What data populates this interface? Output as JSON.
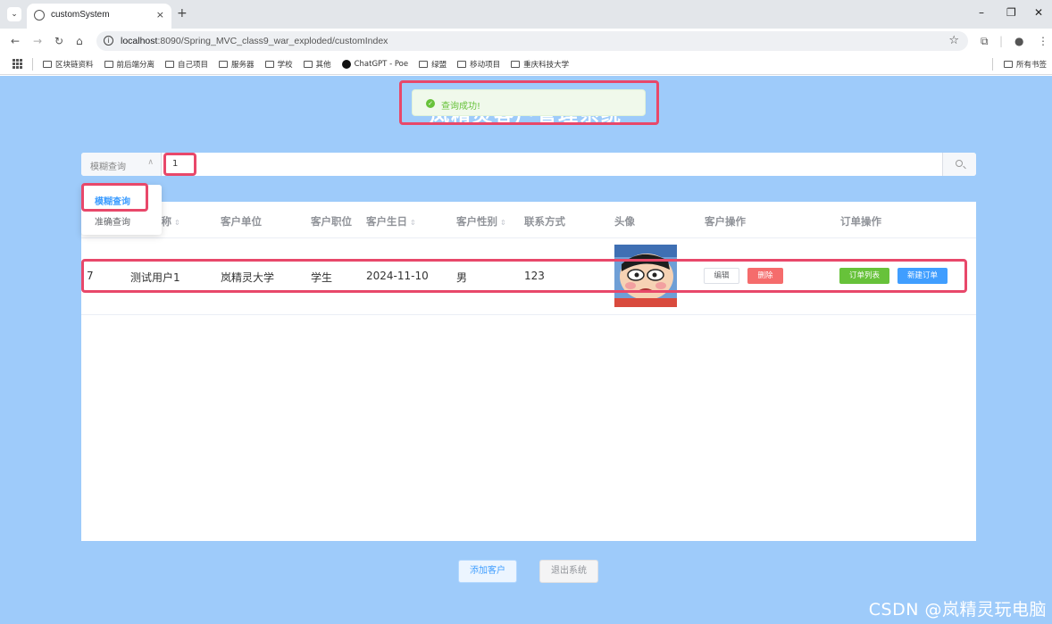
{
  "browser": {
    "tab_title": "customSystem",
    "tab_close": "×",
    "new_tab": "+",
    "window_controls": [
      "–",
      "❐",
      "✕"
    ],
    "url_host": "localhost",
    "url_rest": ":8090/Spring_MVC_class9_war_exploded/customIndex",
    "bookmarks": [
      "区块链资料",
      "前后端分离",
      "自己项目",
      "服务器",
      "学校",
      "其他",
      "ChatGPT - Poe",
      "绿盟",
      "移动项目",
      "重庆科技大学"
    ],
    "all_bookmarks": "所有书签"
  },
  "page": {
    "title": "岚精灵客户管理系统",
    "toast": "查询成功!",
    "search": {
      "mode": "模糊查询",
      "value": "1",
      "options": [
        "模糊查询",
        "准确查询"
      ]
    },
    "table": {
      "headers": [
        "客户名称",
        "客户单位",
        "客户职位",
        "客户生日",
        "客户性别",
        "联系方式",
        "头像",
        "客户操作",
        "订单操作"
      ],
      "rows": [
        {
          "id": "7",
          "name": "测试用户1",
          "unit": "岚精灵大学",
          "position": "学生",
          "birthday": "2024-11-10",
          "gender": "男",
          "phone": "123"
        }
      ],
      "actions": {
        "edit": "编辑",
        "delete": "删除",
        "orders": "订单列表",
        "new_order": "新建订单"
      }
    },
    "buttons": {
      "add": "添加客户",
      "exit": "退出系统"
    }
  },
  "watermark": "CSDN @岚精灵玩电脑",
  "colors": {
    "page_bg": "#9ecbfa",
    "highlight": "#e8486a",
    "success": "#67c23a",
    "danger": "#f56c6c",
    "primary": "#409eff"
  }
}
